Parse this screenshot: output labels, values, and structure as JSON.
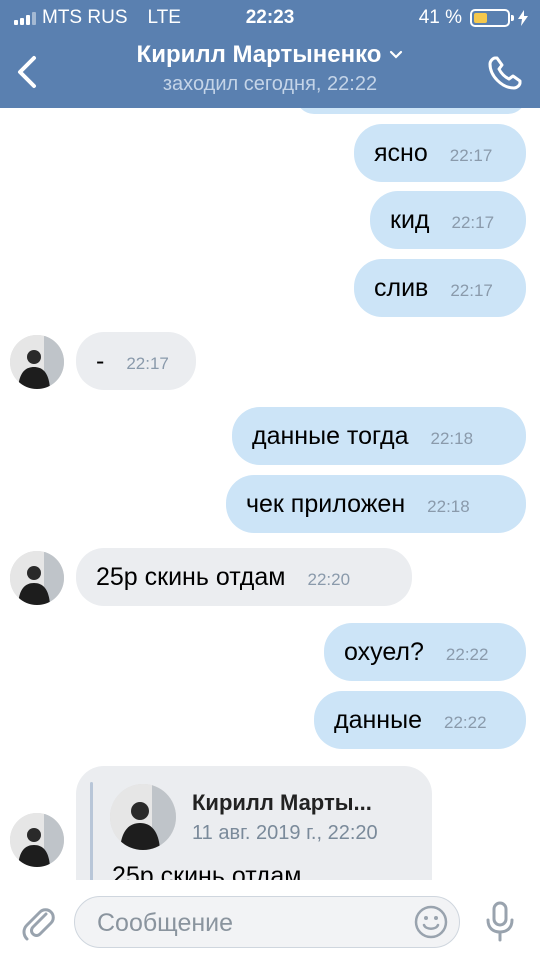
{
  "status_bar": {
    "carrier": "MTS RUS",
    "network": "LTE",
    "time": "22:23",
    "battery_text": "41 %",
    "battery_level": 0.41
  },
  "header": {
    "back_icon": "chevron-left-icon",
    "title": "Кирилл Мартыненко",
    "subtitle": "заходил сегодня, 22:22",
    "call_icon": "phone-icon",
    "bg_color": "#5a80b0"
  },
  "messages": [
    {
      "text": "ясно",
      "time": "22:17"
    },
    {
      "text": "кид",
      "time": "22:17"
    },
    {
      "text": "слив",
      "time": "22:17"
    },
    {
      "text": "-",
      "time": "22:17"
    },
    {
      "text": "данные тогда",
      "time": "22:18"
    },
    {
      "text": "чек приложен",
      "time": "22:18"
    },
    {
      "text": "25р скинь отдам",
      "time": "22:20"
    },
    {
      "text": "охуел?",
      "time": "22:22"
    },
    {
      "text": "данные",
      "time": "22:22"
    }
  ],
  "forwarded": {
    "name": "Кирилл Марты...",
    "date": "11 авг. 2019 г., 22:20",
    "text": "25р скинь отдам"
  },
  "input": {
    "placeholder": "Сообщение",
    "attach_icon": "paperclip-icon",
    "emoji_icon": "smile-icon",
    "mic_icon": "microphone-icon"
  },
  "colors": {
    "outgoing_bubble": "#cce4f7",
    "incoming_bubble": "#ebedf0",
    "time_text": "#8a9aab"
  }
}
